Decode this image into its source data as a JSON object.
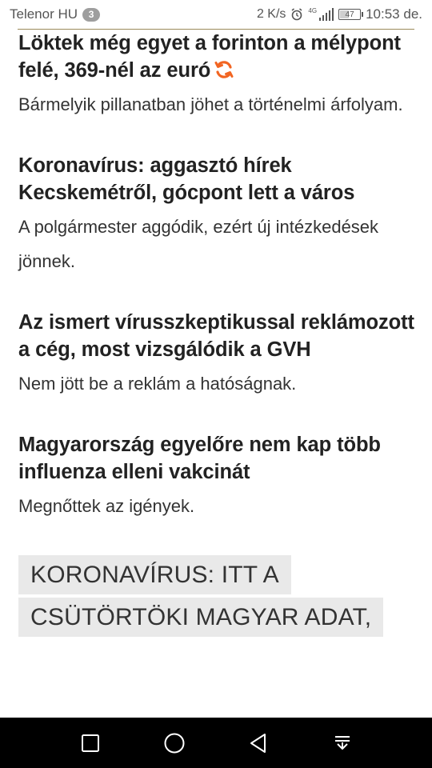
{
  "status_bar": {
    "carrier": "Telenor HU",
    "notification_count": "3",
    "net_speed": "2 K/s",
    "network_type": "4G",
    "battery_level": "47",
    "time": "10:53 de."
  },
  "articles": [
    {
      "headline": "Löktek még egyet a forinton a mélypont felé, 369-nél az euró",
      "lead": "Bármelyik pillanatban jöhet a történelmi árfolyam.",
      "icon": "refresh-icon"
    },
    {
      "headline": "Koronavírus: aggasztó hírek Kecskemétről, gócpont lett a város",
      "lead": "A polgármester aggódik, ezért új intézkedések jönnek."
    },
    {
      "headline": "Az ismert vírusszkeptikussal reklámozott a cég, most vizsgálódik a GVH",
      "lead": "Nem jött be a reklám a hatóságnak."
    },
    {
      "headline": "Magyarország egyelőre nem kap több influenza elleni vakcinát",
      "lead": "Megnőttek az igények."
    }
  ],
  "tag_block": {
    "text": "Koronavírus: itt a csütörtöki magyar adat,"
  },
  "nav_bar": {
    "buttons": [
      "recent-apps-icon",
      "home-icon",
      "back-icon",
      "notification-pull-icon"
    ]
  },
  "colors": {
    "accent_orange": "#f26522",
    "tag_background": "#e9e9e9",
    "nav_background": "#000000"
  }
}
